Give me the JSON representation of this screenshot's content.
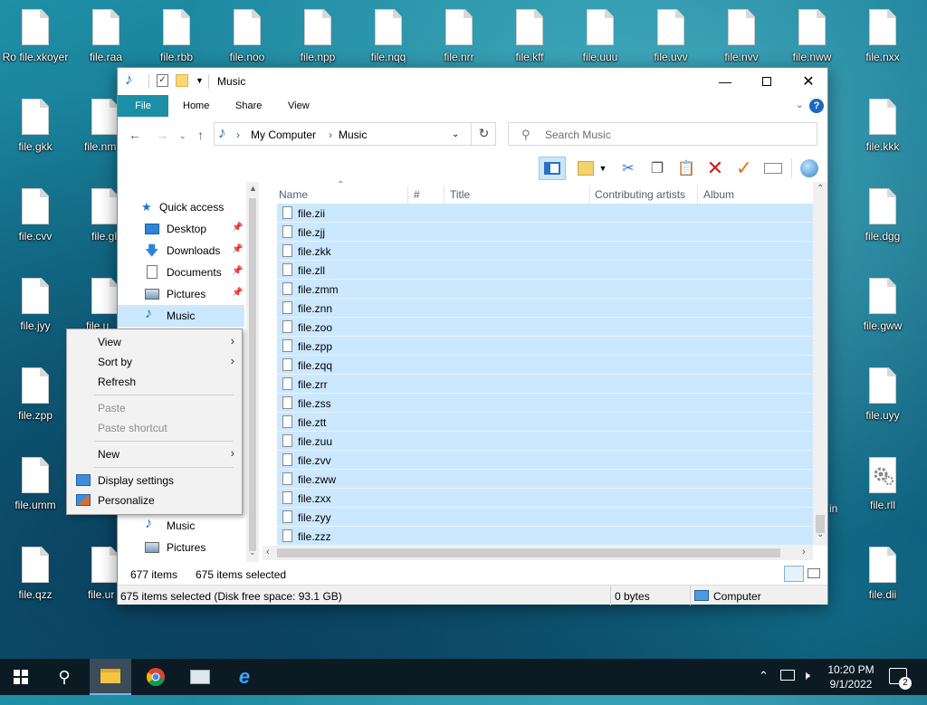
{
  "desktop": {
    "row1": [
      "Ro file.xkoyer",
      "file.raa",
      "file.rbb",
      "file.noo",
      "file.npp",
      "file.nqq",
      "file.nrr",
      "file.kff",
      "file.uuu",
      "file.uvv",
      "file.nvv",
      "file.nww",
      "file.nxx"
    ],
    "left_col": [
      "file.gkk",
      "file.cvv",
      "file.jyy",
      "file.zpp",
      "file.umm",
      "file.qzz"
    ],
    "second_col": [
      "file.nm",
      "file.gl",
      "file.u",
      "file.ur"
    ],
    "right_col": [
      "file.kkk",
      "file.dgg",
      "file.gww",
      "file.uyy",
      "file.rll",
      "file.dii"
    ],
    "partial_labels": [
      "file.u",
      "in"
    ]
  },
  "explorer": {
    "title": "Music",
    "tabs": [
      "File",
      "Home",
      "Share",
      "View"
    ],
    "address": {
      "root": "My Computer",
      "current": "Music"
    },
    "search_placeholder": "Search Music",
    "nav": {
      "quick_access": "Quick access",
      "items": [
        "Desktop",
        "Downloads",
        "Documents",
        "Pictures",
        "Music"
      ],
      "bottom_items": [
        "Music",
        "Pictures"
      ]
    },
    "columns": [
      "Name",
      "#",
      "Title",
      "Contributing artists",
      "Album"
    ],
    "files": [
      "file.zii",
      "file.zjj",
      "file.zkk",
      "file.zll",
      "file.zmm",
      "file.znn",
      "file.zoo",
      "file.zpp",
      "file.zqq",
      "file.zrr",
      "file.zss",
      "file.ztt",
      "file.zuu",
      "file.zvv",
      "file.zww",
      "file.zxx",
      "file.zyy",
      "file.zzz"
    ],
    "status": {
      "item_count": "677 items",
      "selected_count": "675 items selected",
      "details": "675 items selected (Disk free space: 93.1 GB)",
      "size": "0 bytes",
      "location": "Computer"
    }
  },
  "context_menu": {
    "view": "View",
    "sort_by": "Sort by",
    "refresh": "Refresh",
    "paste": "Paste",
    "paste_shortcut": "Paste shortcut",
    "new": "New",
    "display_settings": "Display settings",
    "personalize": "Personalize"
  },
  "taskbar": {
    "time": "10:20 PM",
    "date": "9/1/2022",
    "notification_count": "2"
  },
  "colors": {
    "ribbon_file": "#1c8fa6",
    "selection": "#cce8ff",
    "taskbar": "#0c1a24"
  }
}
